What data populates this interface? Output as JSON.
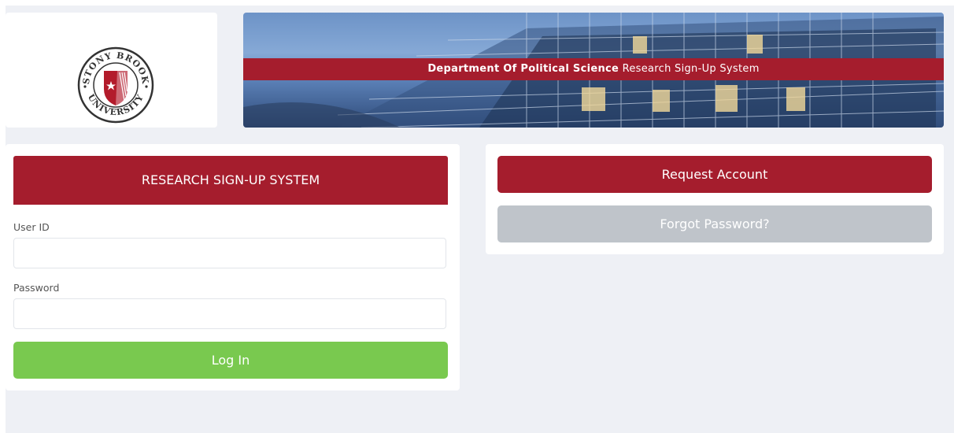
{
  "logo": {
    "text_top": "STONY BROOK",
    "text_bottom": "UNIVERSITY",
    "icon": "stony-brook-seal"
  },
  "banner": {
    "title_bold": "Department Of Political Science",
    "title_rest": " Research Sign-Up System"
  },
  "login": {
    "header": "RESEARCH SIGN-UP SYSTEM",
    "userid_label": "User ID",
    "userid_value": "",
    "password_label": "Password",
    "password_value": "",
    "login_button": "Log In"
  },
  "actions": {
    "request_button": "Request Account",
    "forgot_button": "Forgot Password?"
  },
  "colors": {
    "brand_red": "#a51d2d",
    "login_green": "#79c94f",
    "disabled_gray": "#bfc4ca",
    "page_bg": "#eef0f5"
  }
}
